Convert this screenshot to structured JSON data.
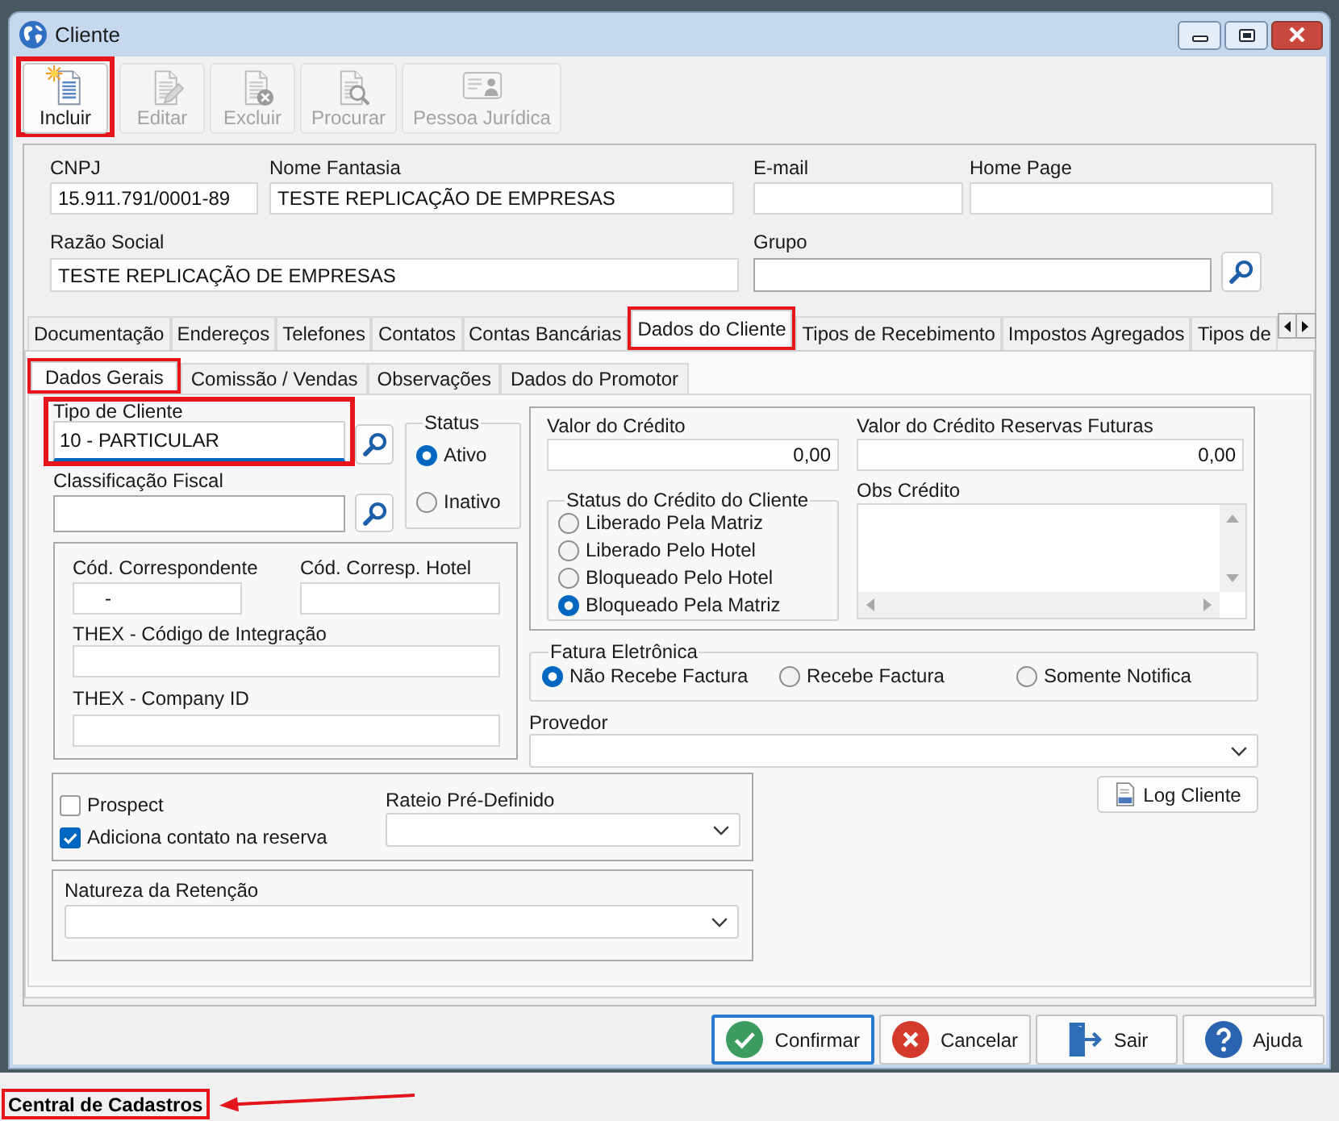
{
  "window": {
    "title": "Cliente"
  },
  "toolbar": [
    {
      "kind": "new",
      "label": "Incluir",
      "disabled": false,
      "highlighted": true
    },
    {
      "kind": "edit",
      "label": "Editar",
      "disabled": true,
      "highlighted": false
    },
    {
      "kind": "delete",
      "label": "Excluir",
      "disabled": true,
      "highlighted": false
    },
    {
      "kind": "search",
      "label": "Procurar",
      "disabled": true,
      "highlighted": false
    },
    {
      "kind": "card",
      "label": "Pessoa Jurídica",
      "disabled": true,
      "highlighted": false
    }
  ],
  "header": {
    "cnpj": {
      "label": "CNPJ",
      "value": "15.911.791/0001-89"
    },
    "nome_fantasia": {
      "label": "Nome Fantasia",
      "value": "TESTE REPLICAÇÃO DE EMPRESAS"
    },
    "email": {
      "label": "E-mail"
    },
    "home_page": {
      "label": "Home Page"
    },
    "razao_social": {
      "label": "Razão Social",
      "value": "TESTE REPLICAÇÃO DE EMPRESAS"
    },
    "grupo": {
      "label": "Grupo"
    }
  },
  "tabs": [
    {
      "label": "Documentação",
      "selected": false,
      "highlighted": false
    },
    {
      "label": "Endereços",
      "selected": false,
      "highlighted": false
    },
    {
      "label": "Telefones",
      "selected": false,
      "highlighted": false
    },
    {
      "label": "Contatos",
      "selected": false,
      "highlighted": false
    },
    {
      "label": "Contas Bancárias",
      "selected": false,
      "highlighted": false
    },
    {
      "label": "Dados do Cliente",
      "selected": true,
      "highlighted": true
    },
    {
      "label": "Tipos de Recebimento",
      "selected": false,
      "highlighted": false
    },
    {
      "label": "Impostos Agregados",
      "selected": false,
      "highlighted": false
    },
    {
      "label": "Tipos de",
      "selected": false,
      "highlighted": false
    }
  ],
  "subtabs": [
    {
      "label": "Dados Gerais",
      "selected": true,
      "highlighted": true
    },
    {
      "label": "Comissão / Vendas",
      "selected": false,
      "highlighted": false
    },
    {
      "label": "Observações",
      "selected": false,
      "highlighted": false
    },
    {
      "label": "Dados do Promotor",
      "selected": false,
      "highlighted": false
    }
  ],
  "dados_gerais": {
    "tipo_de_cliente": {
      "label": "Tipo de Cliente",
      "value": "10 - PARTICULAR",
      "focused": true,
      "highlighted": true
    },
    "classificacao_fiscal": {
      "label": "Classificação Fiscal"
    },
    "status": {
      "legend": "Status",
      "options": [
        {
          "label": "Ativo",
          "selected": true
        },
        {
          "label": "Inativo",
          "selected": false
        }
      ]
    },
    "cod_correspondente": {
      "label": "Cód. Correspondente",
      "value": "-"
    },
    "cod_corresp_hotel": {
      "label": "Cód. Corresp. Hotel"
    },
    "thex_codigo_integracao": {
      "label": "THEX - Código de Integração"
    },
    "thex_company_id": {
      "label": "THEX - Company ID"
    },
    "valor_do_credito": {
      "label": "Valor do Crédito",
      "value": "0,00"
    },
    "valor_credito_reservas_futuras": {
      "label": "Valor do Crédito Reservas Futuras",
      "value": "0,00"
    },
    "status_do_credito": {
      "legend": "Status do Crédito do Cliente",
      "options": [
        {
          "label": "Liberado Pela Matriz",
          "selected": false
        },
        {
          "label": "Liberado Pelo Hotel",
          "selected": false
        },
        {
          "label": "Bloqueado Pelo Hotel",
          "selected": false
        },
        {
          "label": "Bloqueado Pela Matriz",
          "selected": true
        }
      ]
    },
    "obs_credito": {
      "label": "Obs Crédito"
    },
    "fatura_eletronica": {
      "legend": "Fatura Eletrônica",
      "options": [
        {
          "label": "Não Recebe Factura",
          "selected": true
        },
        {
          "label": "Recebe Factura",
          "selected": false
        },
        {
          "label": "Somente Notifica",
          "selected": false
        }
      ]
    },
    "provedor": {
      "label": "Provedor"
    },
    "checkboxes": [
      {
        "label": "Prospect",
        "checked": false
      },
      {
        "label": "Adiciona contato na reserva",
        "checked": true
      }
    ],
    "rateio_pre_definido": {
      "label": "Rateio Pré-Definido"
    },
    "natureza_da_retencao": {
      "label": "Natureza da Retenção"
    },
    "log_button": {
      "label": "Log Cliente"
    }
  },
  "footer_buttons": [
    {
      "kind": "confirm",
      "label": "Confirmar",
      "focused": true
    },
    {
      "kind": "cancel",
      "label": "Cancelar",
      "focused": false
    },
    {
      "kind": "exit",
      "label": "Sair",
      "focused": false
    },
    {
      "kind": "help",
      "label": "Ajuda",
      "focused": false
    }
  ],
  "status_bar": {
    "text": "Central de Cadastros",
    "highlighted": true
  }
}
